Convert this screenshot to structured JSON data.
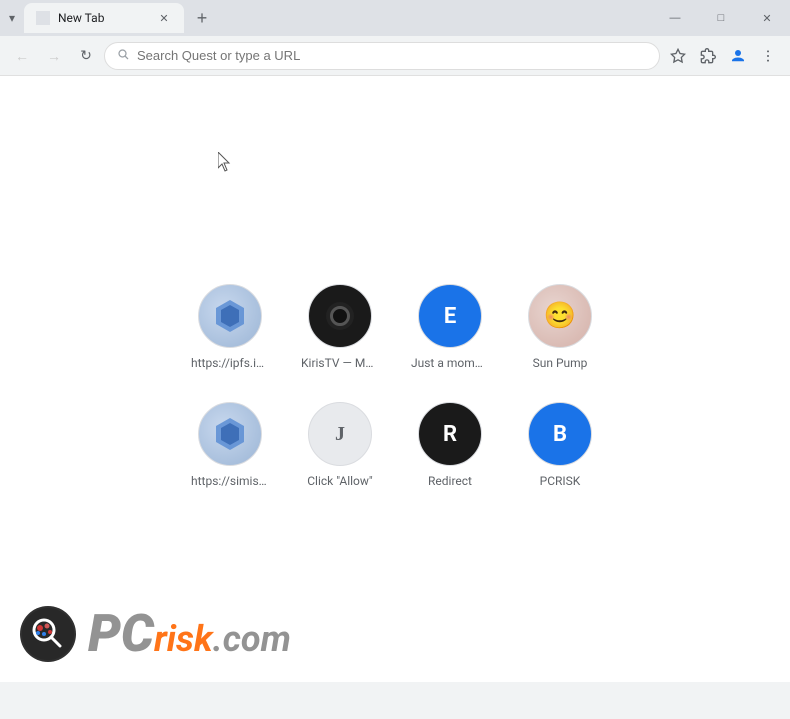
{
  "browser": {
    "title": "New Tab",
    "addressBar": {
      "placeholder": "Search Quest or type a URL",
      "value": ""
    },
    "windowControls": {
      "minimize": "—",
      "maximize": "□",
      "close": "✕"
    }
  },
  "speedDial": {
    "items": [
      {
        "id": "ipfs1",
        "label": "https://ipfs.io...",
        "iconType": "ipfs",
        "iconChar": ""
      },
      {
        "id": "kiris",
        "label": "KirisTV — Mo...",
        "iconType": "kiris",
        "iconChar": "⏺"
      },
      {
        "id": "just",
        "label": "Just a mome...",
        "iconType": "just",
        "iconChar": "E"
      },
      {
        "id": "sunpump",
        "label": "Sun Pump",
        "iconType": "sunpump",
        "iconChar": "☺"
      },
      {
        "id": "simise",
        "label": "https://simise...",
        "iconType": "simise",
        "iconChar": ""
      },
      {
        "id": "click",
        "label": "Click \"Allow\"",
        "iconType": "click",
        "iconChar": "J"
      },
      {
        "id": "redirect",
        "label": "Redirect",
        "iconType": "redirect",
        "iconChar": "R"
      },
      {
        "id": "pcrisk",
        "label": "PCRISK",
        "iconType": "pcrisk",
        "iconChar": "B"
      }
    ]
  },
  "watermark": {
    "pc": "PC",
    "risk": "risk",
    "dotcom": ".com"
  }
}
